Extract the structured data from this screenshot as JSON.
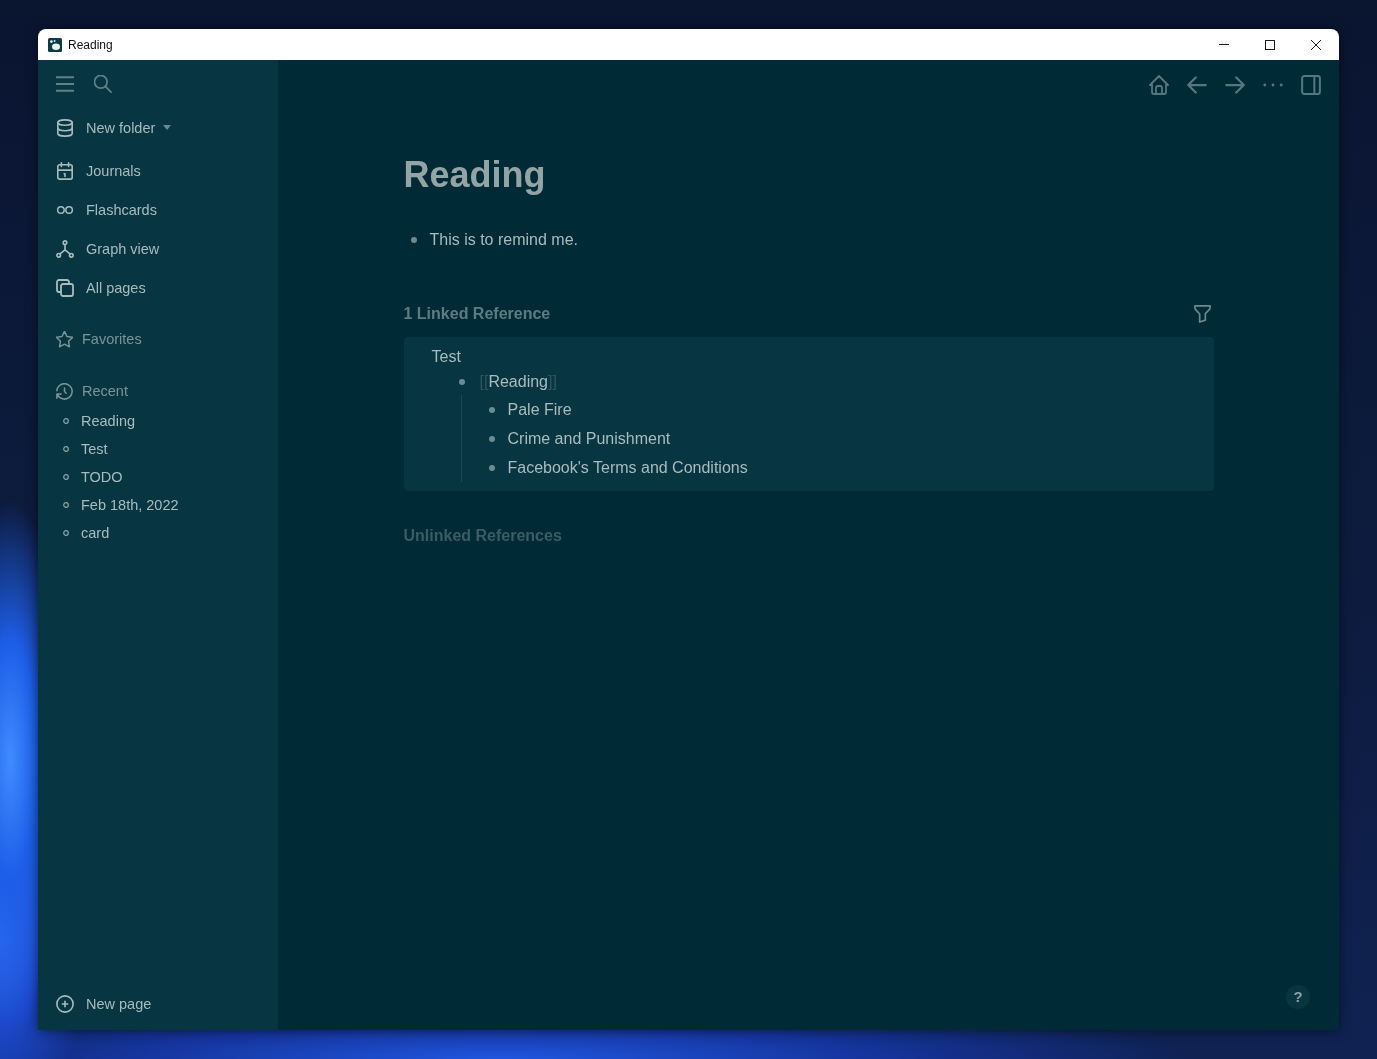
{
  "window": {
    "title": "Reading"
  },
  "sidebar": {
    "folder": {
      "label": "New folder"
    },
    "nav_items": [
      {
        "label": "Journals",
        "kind": "journals"
      },
      {
        "label": "Flashcards",
        "kind": "flashcards"
      },
      {
        "label": "Graph view",
        "kind": "graph"
      },
      {
        "label": "All pages",
        "kind": "pages"
      }
    ],
    "favorites": {
      "label": "Favorites"
    },
    "recent": {
      "label": "Recent",
      "items": [
        "Reading",
        "Test",
        "TODO",
        "Feb 18th, 2022",
        "card"
      ]
    },
    "new_page": {
      "label": "New page"
    }
  },
  "page": {
    "title": "Reading",
    "blocks": [
      {
        "text": "This is to remind me."
      }
    ],
    "linked_references": {
      "heading": "1 Linked Reference",
      "groups": [
        {
          "page": "Test",
          "blocks": [
            {
              "kind": "page_ref",
              "open_mark": "[[",
              "text": "Reading",
              "close_mark": "]]",
              "children": [
                {
                  "text": "Pale Fire"
                },
                {
                  "text": "Crime and Punishment"
                },
                {
                  "text": "Facebook's Terms and Conditions"
                }
              ]
            }
          ]
        }
      ]
    },
    "unlinked_references": {
      "heading": "Unlinked References"
    }
  },
  "help": {
    "label": "?"
  }
}
